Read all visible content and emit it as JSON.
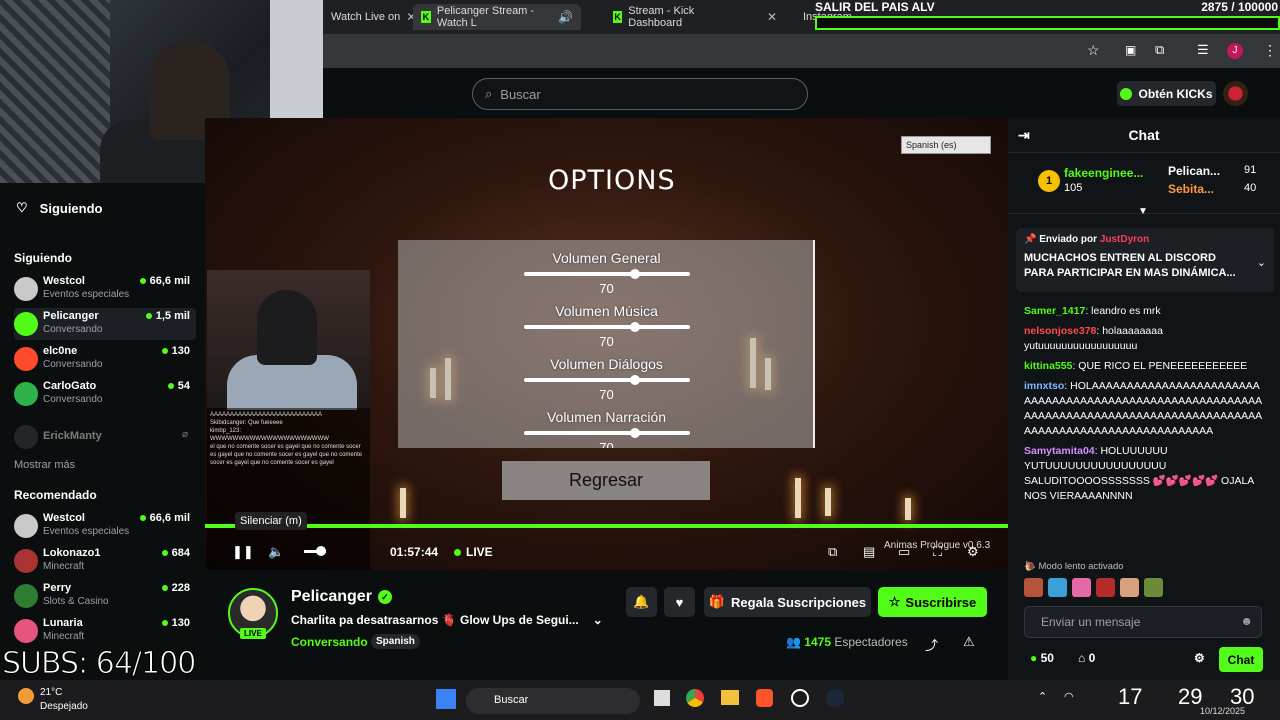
{
  "browser": {
    "tabs": [
      {
        "label": "Watch Live on"
      },
      {
        "label": "Pelicanger Stream - Watch L"
      },
      {
        "label": "Stream - Kick Dashboard"
      },
      {
        "label": "Instagram"
      }
    ]
  },
  "overlay": {
    "goal_title": "SALIR DEL PAIS ALV",
    "goal_value": "2875 / 100000",
    "subs_counter": "SUBS: 64/100"
  },
  "kick": {
    "search_placeholder": "Buscar",
    "kicks_button": "Obtén KICKs"
  },
  "sidebar": {
    "following_header": "Siguiendo",
    "following_label": "Siguiendo",
    "following": [
      {
        "name": "Westcol",
        "category": "Eventos especiales",
        "viewers": "66,6 mil",
        "color": "#c9c9c9"
      },
      {
        "name": "Pelicanger",
        "category": "Conversando",
        "viewers": "1,5 mil",
        "color": "#53fc18"
      },
      {
        "name": "elc0ne",
        "category": "Conversando",
        "viewers": "130",
        "color": "#ff4b2b"
      },
      {
        "name": "CarloGato",
        "category": "Conversando",
        "viewers": "54",
        "color": "#2fb24a"
      },
      {
        "name": "ErickManty",
        "category": "",
        "viewers": "",
        "color": "#444"
      }
    ],
    "show_more": "Mostrar más",
    "recommended_label": "Recomendado",
    "recommended": [
      {
        "name": "Westcol",
        "category": "Eventos especiales",
        "viewers": "66,6 mil",
        "color": "#c9c9c9"
      },
      {
        "name": "Lokonazo1",
        "category": "Minecraft",
        "viewers": "684",
        "color": "#a33"
      },
      {
        "name": "Perry",
        "category": "Slots & Casino",
        "viewers": "228",
        "color": "#2e7d32"
      },
      {
        "name": "Lunaria",
        "category": "Minecraft",
        "viewers": "130",
        "color": "#e75480"
      }
    ]
  },
  "game": {
    "title": "OPTIONS",
    "language": "Spanish (es)",
    "settings": [
      {
        "label": "Volumen General",
        "value": "70"
      },
      {
        "label": "Volumen Música",
        "value": "70"
      },
      {
        "label": "Volumen Diálogos",
        "value": "70"
      },
      {
        "label": "Volumen Narración",
        "value": "70"
      }
    ],
    "back_button": "Regresar",
    "version": "Animas Prologue v0.6.3"
  },
  "player": {
    "tooltip": "Silenciar (m)",
    "elapsed": "01:57:44",
    "live_label": "LIVE",
    "progress": 1.0
  },
  "stream": {
    "name": "Pelicanger",
    "live_badge": "LIVE",
    "title": "Charlita pa desatrasarnos 🫀 Glow Ups de Segui...",
    "category": "Conversando",
    "language": "Spanish",
    "gift_button": "Regala Suscripciones",
    "subscribe_button": "Suscribirse",
    "viewers": "1475",
    "viewers_label": "Espectadores"
  },
  "chat": {
    "title": "Chat",
    "leaderboard": [
      {
        "rank": "1",
        "name": "fakeenginee...",
        "score": "105"
      },
      {
        "name": "Pelican...",
        "score": "91"
      },
      {
        "name": "Sebita...",
        "score": "40"
      }
    ],
    "pinned": {
      "sent_by_label": "Enviado por",
      "user": "JustDyron",
      "text": "MUCHACHOS ENTREN AL DISCORD PARA PARTICIPAR EN MAS DINÁMICA..."
    },
    "messages": [
      {
        "user": "Samer_1417",
        "color": "#53fc18",
        "text": "leandro es mrk"
      },
      {
        "user": "nelsonjose378",
        "color": "#ff4b4b",
        "text": "holaaaaaaaa yutuuuuuuuuuuuuuuuuu"
      },
      {
        "user": "kittina555",
        "color": "#53fc18",
        "text": "QUE RICO EL PENEEEEEEEEEEE"
      },
      {
        "user": "imnxtso",
        "color": "#7ab8ff",
        "text": "HOLAAAAAAAAAAAAAAAAAAAAAAAAAAAAAAAAAAAAAAAAAAAAAAAAAAAAAAAAAAAAAAAAAAAAAAAAAAAAAAAAAAAAAAAAAAAAAAAAAAAAAAAAAAAAAAAAAAAAAAA"
      },
      {
        "user": "Samytamita04",
        "color": "#d58cff",
        "text": "HOLUUUUUU YUTUUUUUUUUUUUUUUUU SALUDITOOOOSSSSSSS 💕💕💕💕💕 OJALA NOS VIERAAAANNNN"
      }
    ],
    "slow_mode": "Modo lento activado",
    "input_placeholder": "Enviar un mensaje",
    "points": "50",
    "balance": "0",
    "send_button": "Chat"
  },
  "taskbar": {
    "weather_temp": "21°C",
    "weather_desc": "Despejado",
    "search": "Buscar",
    "overlay_hours": "17",
    "overlay_minutes": "29",
    "overlay_seconds": "30",
    "date": "10/12/2025"
  }
}
